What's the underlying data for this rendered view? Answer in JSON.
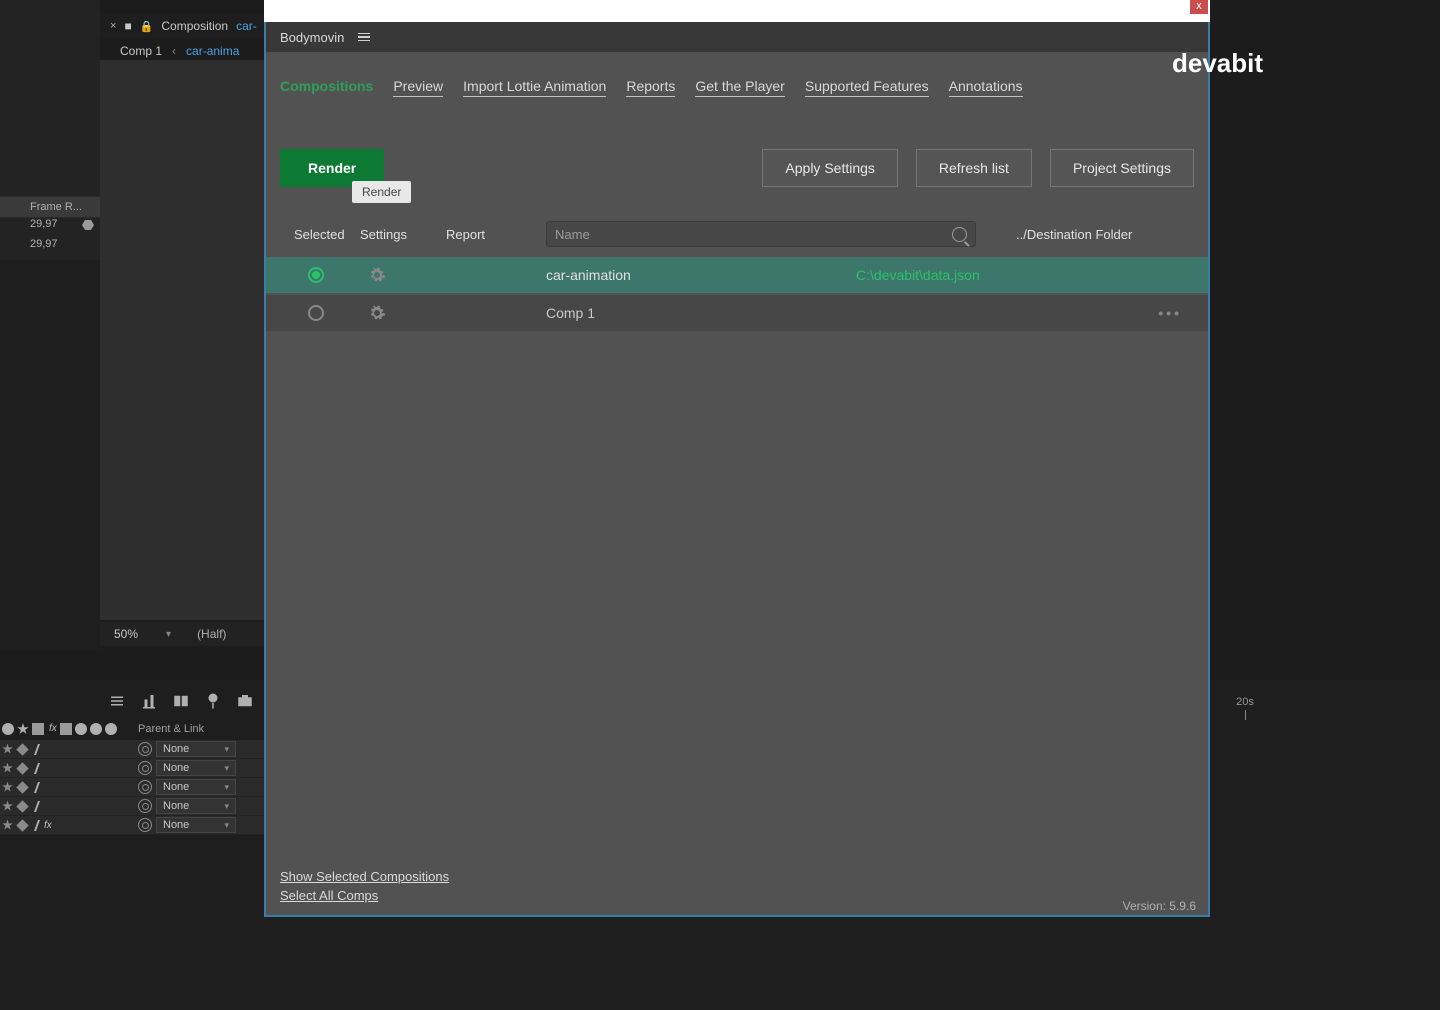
{
  "ae": {
    "tab_label_prefix": "Composition",
    "tab_comp_name": "car-",
    "viewer_tab_1": "Comp 1",
    "viewer_tab_2": "car-anima",
    "frame_header": "Frame R...",
    "fps_1": "29,97",
    "fps_2": "29,97",
    "zoom": "50%",
    "res": "(Half)",
    "parent_header": "Parent & Link",
    "none_label": "None",
    "time_20s": "20s"
  },
  "bm": {
    "title": "Bodymovin",
    "nav": {
      "compositions": "Compositions",
      "preview": "Preview",
      "import": "Import Lottie Animation",
      "reports": "Reports",
      "get_player": "Get the Player",
      "supported": "Supported Features",
      "annotations": "Annotations"
    },
    "btn_render": "Render",
    "tip_render": "Render",
    "btn_apply": "Apply Settings",
    "btn_refresh": "Refresh list",
    "btn_project": "Project Settings",
    "cols": {
      "selected": "Selected",
      "settings": "Settings",
      "report": "Report",
      "name_placeholder": "Name",
      "dest": "../Destination Folder"
    },
    "rows": [
      {
        "name": "car-animation",
        "dest": "C:\\devabit\\data.json",
        "selected": true,
        "dots": ""
      },
      {
        "name": "Comp 1",
        "dest": "",
        "selected": false,
        "dots": "•••"
      }
    ],
    "footer_show": "Show Selected Compositions",
    "footer_select": "Select All Comps",
    "version": "Version: 5.9.6",
    "close_x": "x"
  },
  "watermark": "devabit"
}
